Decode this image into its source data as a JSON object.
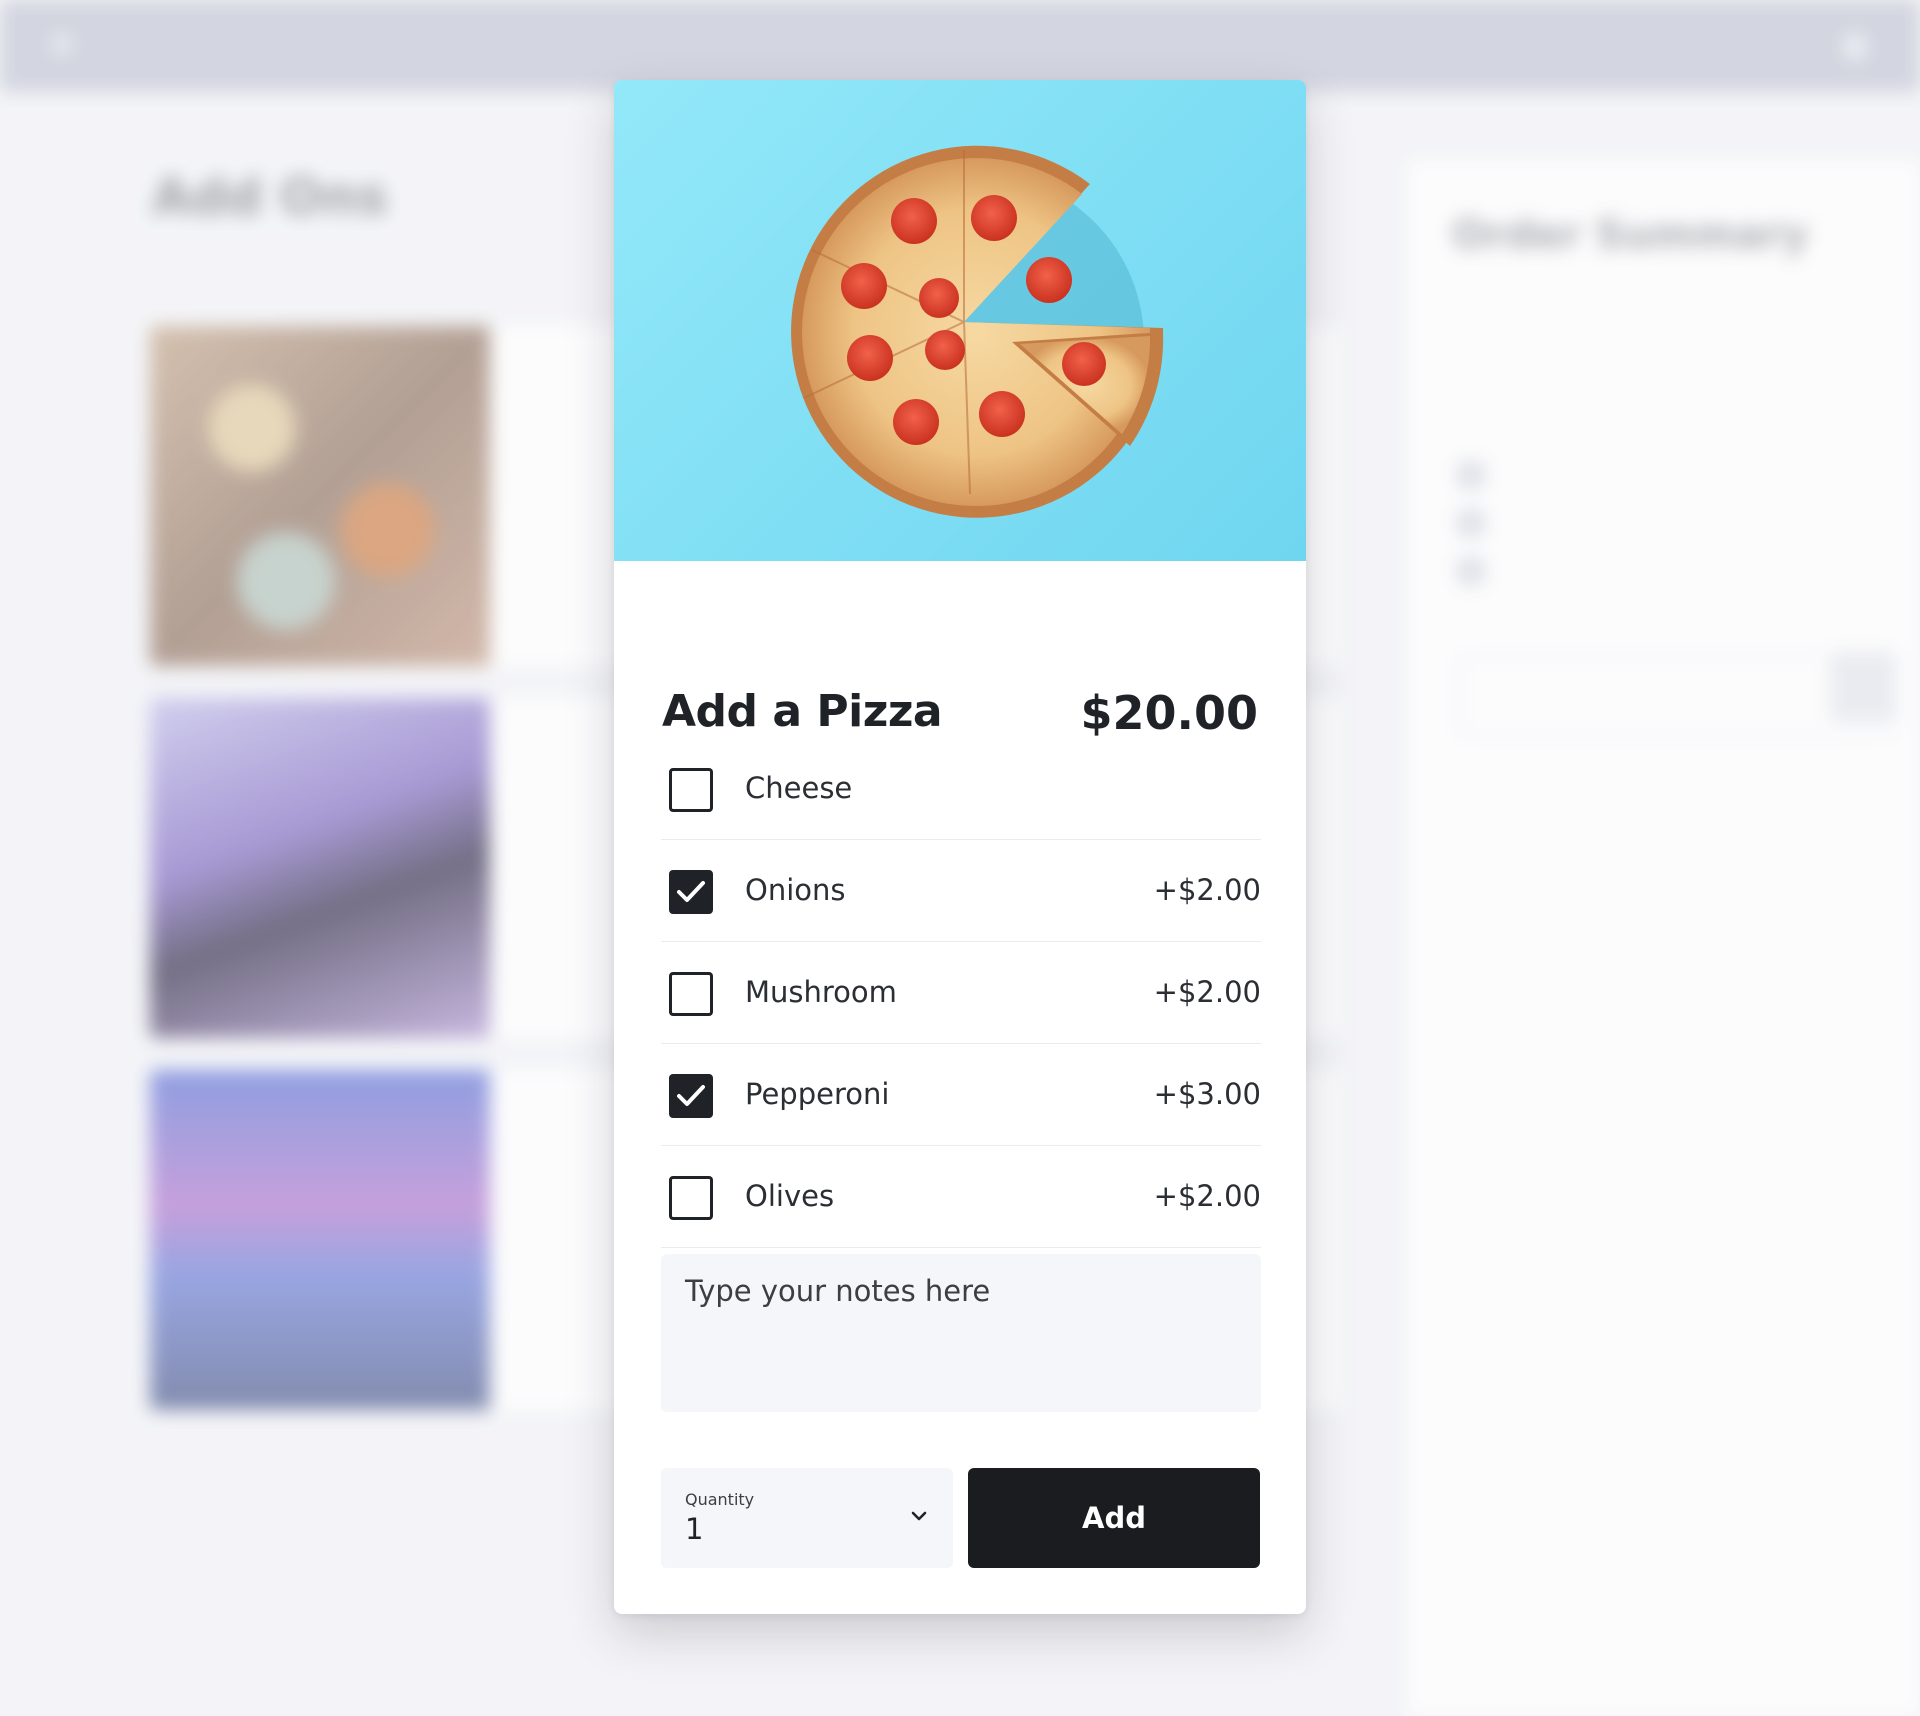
{
  "modal": {
    "title": "Add a Pizza",
    "price": "$20.00",
    "image": "pizza-on-blue-background",
    "options": [
      {
        "label": "Cheese",
        "price": "",
        "checked": false
      },
      {
        "label": "Onions",
        "price": "+$2.00",
        "checked": true
      },
      {
        "label": "Mushroom",
        "price": "+$2.00",
        "checked": false
      },
      {
        "label": "Pepperoni",
        "price": "+$3.00",
        "checked": true
      },
      {
        "label": "Olives",
        "price": "+$2.00",
        "checked": false
      }
    ],
    "notes_placeholder": "Type your notes here",
    "quantity_label": "Quantity",
    "quantity_value": "1",
    "add_label": "Add"
  },
  "background": {
    "page_title": "Add Ons",
    "order_summary_title": "Order Summary"
  },
  "colors": {
    "hero_background": "#7fdff5",
    "primary_button": "#1b1c1f",
    "checkbox_checked": "#1f2226"
  }
}
